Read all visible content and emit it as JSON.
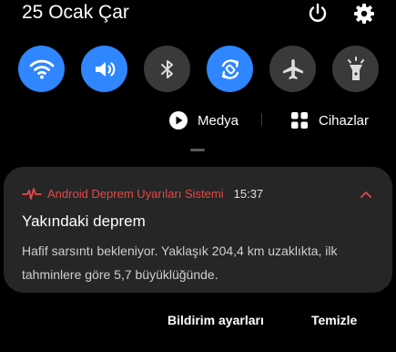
{
  "status_bar": {
    "date": "25 Ocak Çar",
    "icons": [
      "power-icon",
      "settings-icon"
    ]
  },
  "quick_settings": {
    "tiles": [
      {
        "name": "wifi",
        "icon": "wifi-icon",
        "state": "on"
      },
      {
        "name": "sound",
        "icon": "volume-icon",
        "state": "on"
      },
      {
        "name": "bluetooth",
        "icon": "bluetooth-icon",
        "state": "off"
      },
      {
        "name": "auto-rotate",
        "icon": "rotate-icon",
        "state": "on"
      },
      {
        "name": "airplane-mode",
        "icon": "airplane-icon",
        "state": "off"
      },
      {
        "name": "flashlight",
        "icon": "flashlight-icon",
        "state": "off"
      }
    ],
    "media_label": "Medya",
    "devices_label": "Cihazlar"
  },
  "notification": {
    "app_name": "Android Deprem Uyarıları Sistemi",
    "time": "15:37",
    "title": "Yakındaki deprem",
    "body": "Hafif sarsıntı bekleniyor. Yaklaşık 204,4 km uzaklıkta, ilk tahminlere göre 5,7 büyüklüğünde."
  },
  "actions": {
    "settings_label": "Bildirim ayarları",
    "clear_label": "Temizle"
  },
  "colors": {
    "background": "#000000",
    "tile_on": "#2f86ff",
    "tile_off": "#3a3a3a",
    "card": "#262626",
    "alert_red": "#e34848"
  }
}
